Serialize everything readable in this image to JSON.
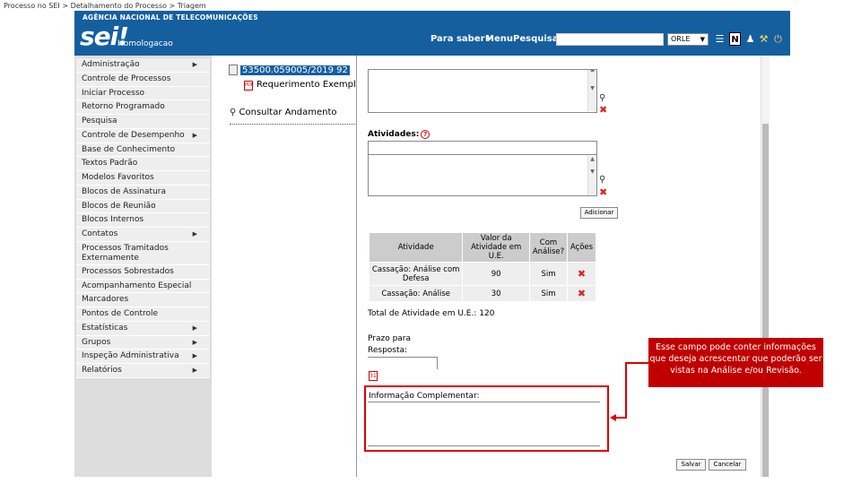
{
  "breadcrumb": "Processo no SEI > Detalhamento do Processo > Triagem",
  "header": {
    "agency": "AGÊNCIA NACIONAL DE TELECOMUNICAÇÕES",
    "logo": "sei!",
    "env": "Homologacao",
    "para_saber": "Para saber+",
    "menu": "Menu",
    "pesquisa": "Pesquisa",
    "unit": "ORLE"
  },
  "menu": [
    {
      "label": "Administração",
      "sub": true
    },
    {
      "label": "Controle de Processos",
      "sub": false
    },
    {
      "label": "Iniciar Processo",
      "sub": false
    },
    {
      "label": "Retorno Programado",
      "sub": false
    },
    {
      "label": "Pesquisa",
      "sub": false
    },
    {
      "label": "Controle de Desempenho",
      "sub": true
    },
    {
      "label": "Base de Conhecimento",
      "sub": false
    },
    {
      "label": "Textos Padrão",
      "sub": false
    },
    {
      "label": "Modelos Favoritos",
      "sub": false
    },
    {
      "label": "Blocos de Assinatura",
      "sub": false
    },
    {
      "label": "Blocos de Reunião",
      "sub": false
    },
    {
      "label": "Blocos Internos",
      "sub": false
    },
    {
      "label": "Contatos",
      "sub": true
    },
    {
      "label": "Processos Tramitados Externamente",
      "sub": false
    },
    {
      "label": "Processos Sobrestados",
      "sub": false
    },
    {
      "label": "Acompanhamento Especial",
      "sub": false
    },
    {
      "label": "Marcadores",
      "sub": false
    },
    {
      "label": "Pontos de Controle",
      "sub": false
    },
    {
      "label": "Estatísticas",
      "sub": true
    },
    {
      "label": "Grupos",
      "sub": true
    },
    {
      "label": "Inspeção Administrativa",
      "sub": true
    },
    {
      "label": "Relatórios",
      "sub": true
    }
  ],
  "tree": {
    "process": "53500.059005/2019 92",
    "document": "Requerimento Exempl",
    "consult": "Consultar Andamento"
  },
  "form": {
    "atividades_label": "Atividades:",
    "adicionar": "Adicionar",
    "table": {
      "headers": [
        "Atividade",
        "Valor da Atividade em U.E.",
        "Com Análise?",
        "Ações"
      ],
      "rows": [
        {
          "atividade": "Cassação: Análise com Defesa",
          "valor": "90",
          "analise": "Sim"
        },
        {
          "atividade": "Cassação: Análise",
          "valor": "30",
          "analise": "Sim"
        }
      ]
    },
    "total": "Total de Atividade em U.E.: 120",
    "prazo_line1": "Prazo para",
    "prazo_line2": "Resposta:",
    "info_label": "Informação Complementar:",
    "salvar": "Salvar",
    "cancelar": "Cancelar"
  },
  "callout": "Esse campo pode conter informações que deseja acrescentar que poderão ser vistas na Análise e/ou Revisão.",
  "colors": {
    "header": "#155f9f",
    "callout": "#c00000",
    "highlight": "#dd0000"
  }
}
